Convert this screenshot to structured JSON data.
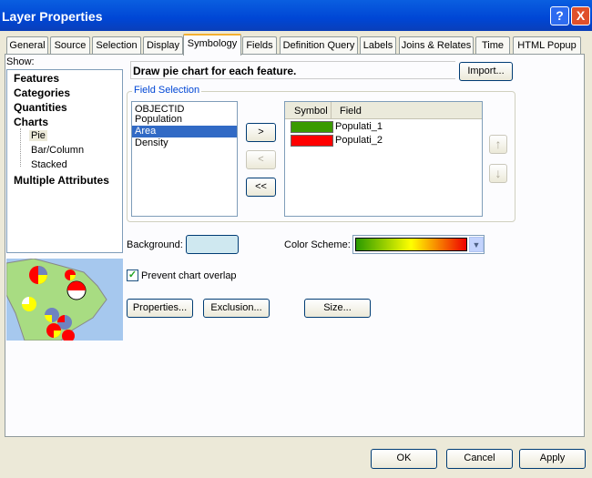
{
  "window": {
    "title": "Layer Properties",
    "help": "?",
    "close": "X"
  },
  "tabs": [
    "General",
    "Source",
    "Selection",
    "Display",
    "Symbology",
    "Fields",
    "Definition Query",
    "Labels",
    "Joins & Relates",
    "Time",
    "HTML Popup"
  ],
  "show": {
    "label": "Show:",
    "items": [
      "Features",
      "Categories",
      "Quantities",
      "Charts"
    ],
    "sub": [
      "Pie",
      "Bar/Column",
      "Stacked"
    ],
    "last": "Multiple Attributes"
  },
  "description": "Draw pie chart for each feature.",
  "import": "Import...",
  "field_selection": {
    "legend": "Field Selection",
    "fields": [
      "OBJECTID",
      "Population",
      "Area",
      "Density"
    ],
    "selected": "Area",
    "add": ">",
    "remove": "<",
    "remove_all": "<<",
    "headers": {
      "symbol": "Symbol",
      "field": "Field"
    },
    "rows": [
      {
        "color": "#3a9a00",
        "field": "Populati_1"
      },
      {
        "color": "#ff0000",
        "field": "Populati_2"
      }
    ]
  },
  "background": {
    "label": "Background:",
    "color": "#cfe8f0"
  },
  "color_scheme": {
    "label": "Color Scheme:"
  },
  "prevent_overlap": {
    "label": "Prevent chart overlap",
    "checked": true
  },
  "buttons": {
    "properties": "Properties...",
    "exclusion": "Exclusion...",
    "size": "Size...",
    "ok": "OK",
    "cancel": "Cancel",
    "apply": "Apply"
  }
}
